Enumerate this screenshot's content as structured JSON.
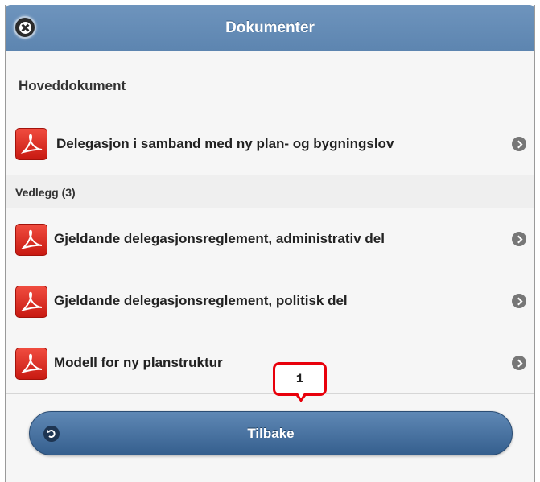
{
  "header": {
    "title": "Dokumenter",
    "close_icon": "close-icon"
  },
  "main_section": {
    "heading": "Hoveddokument",
    "items": [
      {
        "label": "Delegasjon i samband med ny plan- og bygningslov",
        "icon": "pdf-icon"
      }
    ]
  },
  "attachments_section": {
    "heading": "Vedlegg (3)",
    "items": [
      {
        "label": "Gjeldande delegasjonsreglement, administrativ del",
        "icon": "pdf-icon"
      },
      {
        "label": "Gjeldande delegasjonsreglement, politisk del",
        "icon": "pdf-icon"
      },
      {
        "label": "Modell for ny planstruktur",
        "icon": "pdf-icon"
      }
    ]
  },
  "footer": {
    "back_label": "Tilbake",
    "back_icon": "back-icon"
  },
  "annotation": {
    "badge": "1",
    "color": "#e8000b"
  },
  "colors": {
    "header": "#6e94bd",
    "button": "#4b76a4",
    "pdf": "#e0322a"
  }
}
